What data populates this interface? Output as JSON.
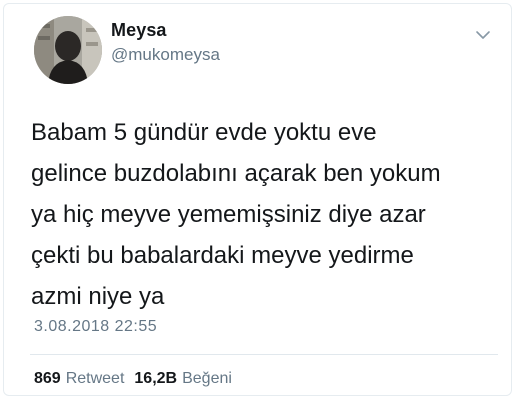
{
  "user": {
    "display_name": "Meysa",
    "handle": "@mukomeysa"
  },
  "tweet": {
    "text": "Babam 5 gündür evde yoktu eve\ngelince buzdolabını açarak ben yokum\nya hiç meyve yememişsiniz diye azar\nçekti bu babalardaki meyve yedirme\nazmi niye ya",
    "timestamp": "3.08.2018 22:55"
  },
  "stats": {
    "retweets_count": "869",
    "retweets_label": "Retweet",
    "likes_count": "16,2B",
    "likes_label": "Beğeni"
  },
  "icons": {
    "menu": "chevron-down-icon"
  },
  "colors": {
    "text_primary": "#14171a",
    "text_secondary": "#657786",
    "border": "#e6ecf0"
  }
}
